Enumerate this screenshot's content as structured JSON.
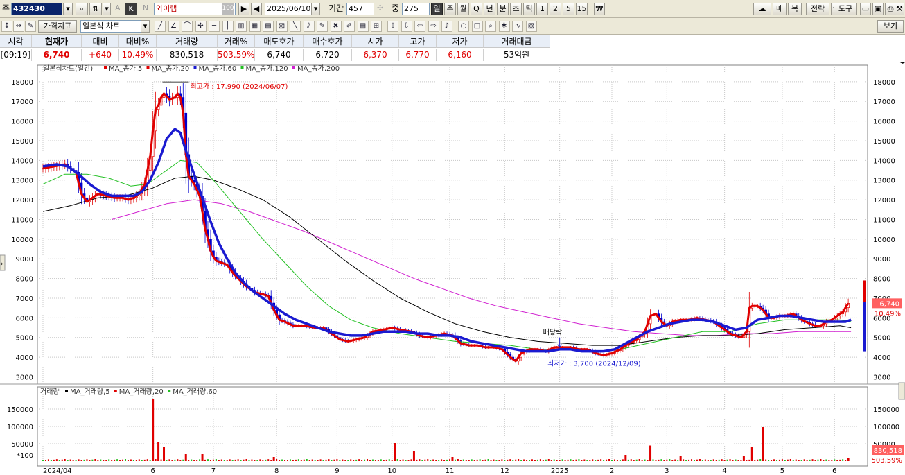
{
  "toolbar1": {
    "market_label": "주",
    "code": "432430",
    "name": "와이랩",
    "name_suffix": "100",
    "date": "2025/06/10",
    "period_label": "기간",
    "period_value": "457",
    "count_label": "중",
    "count_value": "275",
    "k_label": "K",
    "n_label": "N",
    "a_label": "A",
    "intervals": [
      "일",
      "주",
      "월",
      "Q",
      "년",
      "분",
      "초",
      "틱",
      "1",
      "2",
      "5",
      "15"
    ],
    "right_buttons": [
      "매",
      "복",
      "전략",
      "도구"
    ]
  },
  "toolbar2": {
    "indicator_button": "가격지표",
    "chart_type": "일본식 차트",
    "view_button": "보기"
  },
  "quote": {
    "headers": [
      "시각",
      "현재가",
      "대비",
      "대비%",
      "거래량",
      "거래%",
      "매도호가",
      "매수호가",
      "시가",
      "고가",
      "저가",
      "거래대금"
    ],
    "values": [
      "[09:19]",
      "6,740",
      "+640",
      "10.49%",
      "830,518",
      "503.59%",
      "6,740",
      "6,720",
      "6,370",
      "6,770",
      "6,160",
      "53억원"
    ]
  },
  "chart_data": {
    "type": "candlestick",
    "legend": [
      {
        "label": "일본식차트(일간)",
        "color": "#000000"
      },
      {
        "label": "MA_종가,5",
        "color": "#e00000"
      },
      {
        "label": "MA_종가,20",
        "color": "#e00000"
      },
      {
        "label": "MA_종가,60",
        "color": "#1a1ad0"
      },
      {
        "label": "MA_종가,120",
        "color": "#22c022"
      },
      {
        "label": "MA_종가,200",
        "color": "#d020d0"
      }
    ],
    "volume_legend": [
      {
        "label": "거래량",
        "color": "#e00000"
      },
      {
        "label": "MA_거래량,5",
        "color": "#000000"
      },
      {
        "label": "MA_거래량,20",
        "color": "#e00000"
      },
      {
        "label": "MA_거래량,60",
        "color": "#22c022"
      }
    ],
    "price_ylim": [
      2700,
      18700
    ],
    "price_ticks": [
      3000,
      4000,
      5000,
      6000,
      7000,
      8000,
      9000,
      10000,
      11000,
      12000,
      13000,
      14000,
      15000,
      16000,
      17000,
      18000
    ],
    "volume_ylim": [
      0,
      190000
    ],
    "volume_ticks": [
      50000,
      100000,
      150000
    ],
    "volume_unit": "*100",
    "x_ticks": [
      {
        "label": "2024/04",
        "x": 0
      },
      {
        "label": "6",
        "x": 40
      },
      {
        "label": "7",
        "x": 62
      },
      {
        "label": "8",
        "x": 85
      },
      {
        "label": "9",
        "x": 107
      },
      {
        "label": "10",
        "x": 127
      },
      {
        "label": "11",
        "x": 148
      },
      {
        "label": "12",
        "x": 168
      },
      {
        "label": "2025",
        "x": 188
      },
      {
        "label": "2",
        "x": 207
      },
      {
        "label": "3",
        "x": 227
      },
      {
        "label": "4",
        "x": 248
      },
      {
        "label": "5",
        "x": 269
      },
      {
        "label": "6",
        "x": 288
      }
    ],
    "x_range": [
      0,
      296
    ],
    "annotations": {
      "high": {
        "text": "최고가 : 17,990 (2024/06/07)",
        "x": 44,
        "value": 17990
      },
      "low": {
        "text": "최저가 : 3,700 (2024/12/09)",
        "x": 174,
        "value": 3700
      },
      "event": {
        "text": "배당락",
        "x": 188
      }
    },
    "last_price": {
      "label": "6,740",
      "pct": "10.49%"
    },
    "last_volume": {
      "label": "830,518",
      "pct": "503.59%"
    },
    "close_series": [
      [
        0,
        13600
      ],
      [
        4,
        13700
      ],
      [
        8,
        13800
      ],
      [
        12,
        13400
      ],
      [
        14,
        12300
      ],
      [
        16,
        11900
      ],
      [
        18,
        12100
      ],
      [
        20,
        12300
      ],
      [
        23,
        12200
      ],
      [
        26,
        12100
      ],
      [
        29,
        12100
      ],
      [
        31,
        12000
      ],
      [
        33,
        12100
      ],
      [
        35,
        12300
      ],
      [
        37,
        12800
      ],
      [
        39,
        14200
      ],
      [
        40,
        15500
      ],
      [
        41,
        16600
      ],
      [
        42,
        16800
      ],
      [
        43,
        17200
      ],
      [
        44,
        17400
      ],
      [
        46,
        17100
      ],
      [
        48,
        17200
      ],
      [
        49,
        17400
      ],
      [
        50,
        17200
      ],
      [
        51,
        16400
      ],
      [
        52,
        14300
      ],
      [
        53,
        13200
      ],
      [
        55,
        12800
      ],
      [
        57,
        12200
      ],
      [
        58,
        11400
      ],
      [
        59,
        10500
      ],
      [
        60,
        10000
      ],
      [
        61,
        9400
      ],
      [
        62,
        9100
      ],
      [
        63,
        8900
      ],
      [
        65,
        8800
      ],
      [
        67,
        8700
      ],
      [
        69,
        8300
      ],
      [
        71,
        8000
      ],
      [
        74,
        7600
      ],
      [
        77,
        7300
      ],
      [
        80,
        7200
      ],
      [
        82,
        7100
      ],
      [
        84,
        6400
      ],
      [
        86,
        5900
      ],
      [
        88,
        5800
      ],
      [
        91,
        5600
      ],
      [
        95,
        5600
      ],
      [
        99,
        5500
      ],
      [
        102,
        5500
      ],
      [
        105,
        5200
      ],
      [
        108,
        4900
      ],
      [
        111,
        4800
      ],
      [
        114,
        4900
      ],
      [
        117,
        5000
      ],
      [
        120,
        5300
      ],
      [
        124,
        5400
      ],
      [
        127,
        5500
      ],
      [
        130,
        5400
      ],
      [
        134,
        5300
      ],
      [
        137,
        5100
      ],
      [
        140,
        5000
      ],
      [
        143,
        5100
      ],
      [
        146,
        5200
      ],
      [
        149,
        5100
      ],
      [
        152,
        4700
      ],
      [
        155,
        4600
      ],
      [
        158,
        4600
      ],
      [
        161,
        4500
      ],
      [
        164,
        4500
      ],
      [
        167,
        4400
      ],
      [
        170,
        4000
      ],
      [
        172,
        3800
      ],
      [
        174,
        4200
      ],
      [
        177,
        4400
      ],
      [
        180,
        4400
      ],
      [
        183,
        4300
      ],
      [
        186,
        4500
      ],
      [
        189,
        4500
      ],
      [
        192,
        4500
      ],
      [
        195,
        4400
      ],
      [
        198,
        4400
      ],
      [
        201,
        4200
      ],
      [
        204,
        4100
      ],
      [
        207,
        4200
      ],
      [
        210,
        4400
      ],
      [
        213,
        4700
      ],
      [
        216,
        4900
      ],
      [
        219,
        5300
      ],
      [
        221,
        6100
      ],
      [
        223,
        6200
      ],
      [
        225,
        5800
      ],
      [
        227,
        5600
      ],
      [
        229,
        5800
      ],
      [
        232,
        5900
      ],
      [
        235,
        5900
      ],
      [
        238,
        6000
      ],
      [
        241,
        5900
      ],
      [
        244,
        5800
      ],
      [
        247,
        5500
      ],
      [
        250,
        5200
      ],
      [
        252,
        5100
      ],
      [
        254,
        5000
      ],
      [
        256,
        5300
      ],
      [
        257,
        6500
      ],
      [
        258,
        6600
      ],
      [
        260,
        6600
      ],
      [
        262,
        6400
      ],
      [
        264,
        6000
      ],
      [
        266,
        6000
      ],
      [
        268,
        6100
      ],
      [
        270,
        6100
      ],
      [
        273,
        6200
      ],
      [
        276,
        5900
      ],
      [
        279,
        5700
      ],
      [
        281,
        5600
      ],
      [
        283,
        5600
      ],
      [
        285,
        5800
      ],
      [
        287,
        5900
      ],
      [
        289,
        6100
      ],
      [
        291,
        6300
      ],
      [
        293,
        6740
      ]
    ],
    "ma60": [
      [
        0,
        13700
      ],
      [
        5,
        13800
      ],
      [
        9,
        13700
      ],
      [
        13,
        13300
      ],
      [
        17,
        12800
      ],
      [
        21,
        12400
      ],
      [
        25,
        12200
      ],
      [
        29,
        12200
      ],
      [
        33,
        12200
      ],
      [
        36,
        12400
      ],
      [
        39,
        13000
      ],
      [
        42,
        13900
      ],
      [
        45,
        15100
      ],
      [
        48,
        15600
      ],
      [
        50,
        15400
      ],
      [
        52,
        14500
      ],
      [
        55,
        13300
      ],
      [
        58,
        12100
      ],
      [
        61,
        10900
      ],
      [
        64,
        9800
      ],
      [
        67,
        9000
      ],
      [
        70,
        8300
      ],
      [
        73,
        7800
      ],
      [
        76,
        7400
      ],
      [
        80,
        7000
      ],
      [
        84,
        6600
      ],
      [
        88,
        6200
      ],
      [
        92,
        5900
      ],
      [
        96,
        5700
      ],
      [
        100,
        5500
      ],
      [
        104,
        5300
      ],
      [
        108,
        5200
      ],
      [
        112,
        5100
      ],
      [
        116,
        5100
      ],
      [
        120,
        5200
      ],
      [
        124,
        5300
      ],
      [
        128,
        5300
      ],
      [
        132,
        5300
      ],
      [
        136,
        5200
      ],
      [
        140,
        5200
      ],
      [
        144,
        5100
      ],
      [
        148,
        5100
      ],
      [
        152,
        5000
      ],
      [
        156,
        4800
      ],
      [
        160,
        4700
      ],
      [
        164,
        4600
      ],
      [
        168,
        4500
      ],
      [
        172,
        4400
      ],
      [
        176,
        4300
      ],
      [
        180,
        4300
      ],
      [
        184,
        4300
      ],
      [
        188,
        4400
      ],
      [
        192,
        4400
      ],
      [
        196,
        4300
      ],
      [
        200,
        4300
      ],
      [
        204,
        4300
      ],
      [
        208,
        4400
      ],
      [
        212,
        4700
      ],
      [
        216,
        5000
      ],
      [
        220,
        5300
      ],
      [
        224,
        5500
      ],
      [
        228,
        5700
      ],
      [
        232,
        5800
      ],
      [
        236,
        5900
      ],
      [
        240,
        5900
      ],
      [
        244,
        5800
      ],
      [
        248,
        5600
      ],
      [
        252,
        5400
      ],
      [
        256,
        5500
      ],
      [
        260,
        5900
      ],
      [
        264,
        6000
      ],
      [
        268,
        6100
      ],
      [
        272,
        6100
      ],
      [
        276,
        6000
      ],
      [
        280,
        5900
      ],
      [
        284,
        5800
      ],
      [
        288,
        5800
      ],
      [
        292,
        5800
      ],
      [
        294,
        5900
      ]
    ],
    "ma120": [
      [
        0,
        12800
      ],
      [
        8,
        13300
      ],
      [
        16,
        13300
      ],
      [
        24,
        13100
      ],
      [
        32,
        12700
      ],
      [
        38,
        12800
      ],
      [
        44,
        13400
      ],
      [
        50,
        14000
      ],
      [
        56,
        13900
      ],
      [
        62,
        13000
      ],
      [
        68,
        12000
      ],
      [
        74,
        11000
      ],
      [
        80,
        10000
      ],
      [
        88,
        8800
      ],
      [
        96,
        7600
      ],
      [
        104,
        6600
      ],
      [
        112,
        5900
      ],
      [
        120,
        5500
      ],
      [
        130,
        5200
      ],
      [
        140,
        5000
      ],
      [
        150,
        4800
      ],
      [
        160,
        4700
      ],
      [
        170,
        4600
      ],
      [
        180,
        4400
      ],
      [
        190,
        4400
      ],
      [
        200,
        4300
      ],
      [
        210,
        4400
      ],
      [
        220,
        4700
      ],
      [
        230,
        5000
      ],
      [
        240,
        5300
      ],
      [
        250,
        5300
      ],
      [
        260,
        5700
      ],
      [
        270,
        5900
      ],
      [
        280,
        5900
      ],
      [
        290,
        5900
      ],
      [
        294,
        5800
      ]
    ],
    "ma200": [
      [
        25,
        11000
      ],
      [
        35,
        11400
      ],
      [
        45,
        11800
      ],
      [
        55,
        12000
      ],
      [
        65,
        11800
      ],
      [
        75,
        11400
      ],
      [
        85,
        10900
      ],
      [
        95,
        10400
      ],
      [
        105,
        9800
      ],
      [
        115,
        9200
      ],
      [
        125,
        8600
      ],
      [
        135,
        8000
      ],
      [
        145,
        7500
      ],
      [
        155,
        7000
      ],
      [
        165,
        6600
      ],
      [
        175,
        6300
      ],
      [
        185,
        6000
      ],
      [
        195,
        5700
      ],
      [
        205,
        5500
      ],
      [
        215,
        5300
      ],
      [
        225,
        5200
      ],
      [
        235,
        5100
      ],
      [
        245,
        5100
      ],
      [
        255,
        5200
      ],
      [
        265,
        5200
      ],
      [
        275,
        5300
      ],
      [
        285,
        5300
      ],
      [
        294,
        5300
      ]
    ],
    "ma_black": [
      [
        0,
        11400
      ],
      [
        10,
        11700
      ],
      [
        20,
        12100
      ],
      [
        30,
        12200
      ],
      [
        40,
        12600
      ],
      [
        48,
        13100
      ],
      [
        55,
        13200
      ],
      [
        62,
        13000
      ],
      [
        70,
        12600
      ],
      [
        80,
        12000
      ],
      [
        90,
        11100
      ],
      [
        100,
        10000
      ],
      [
        110,
        8900
      ],
      [
        120,
        7900
      ],
      [
        130,
        7000
      ],
      [
        140,
        6300
      ],
      [
        150,
        5700
      ],
      [
        160,
        5300
      ],
      [
        170,
        5000
      ],
      [
        180,
        4800
      ],
      [
        190,
        4700
      ],
      [
        200,
        4600
      ],
      [
        210,
        4600
      ],
      [
        220,
        4800
      ],
      [
        230,
        5000
      ],
      [
        240,
        5100
      ],
      [
        250,
        5100
      ],
      [
        260,
        5200
      ],
      [
        270,
        5400
      ],
      [
        280,
        5500
      ],
      [
        290,
        5600
      ],
      [
        294,
        5500
      ]
    ],
    "volume_spikes": [
      [
        40,
        180000
      ],
      [
        42,
        55000
      ],
      [
        44,
        40000
      ],
      [
        52,
        20000
      ],
      [
        58,
        22000
      ],
      [
        84,
        12000
      ],
      [
        128,
        52000
      ],
      [
        135,
        28000
      ],
      [
        149,
        12000
      ],
      [
        212,
        18000
      ],
      [
        221,
        45000
      ],
      [
        232,
        15000
      ],
      [
        255,
        14000
      ],
      [
        258,
        40000
      ],
      [
        262,
        98000
      ],
      [
        293,
        8305
      ]
    ]
  }
}
